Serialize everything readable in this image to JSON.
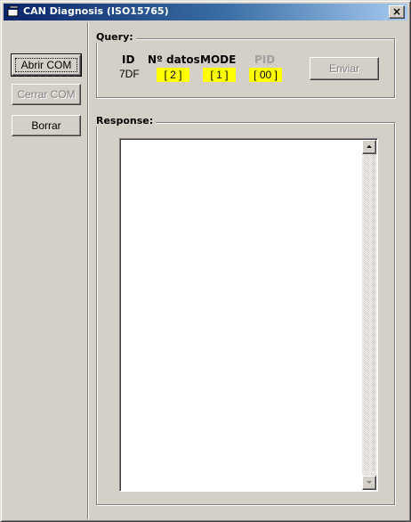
{
  "window": {
    "title": "CAN Diagnosis (ISO15765)",
    "close_glyph": "×"
  },
  "sidebar": {
    "open_label": "Abrir COM",
    "close_label": "Cerrar COM",
    "clear_label": "Borrar"
  },
  "query": {
    "group_label": "Query:",
    "id_label": "ID",
    "id_value": "7DF",
    "ndatos_label": "Nº datos",
    "ndatos_value": "2",
    "mode_label": "MODE",
    "mode_value": "1",
    "pid_label": "PID",
    "pid_value": "00",
    "send_label": "Enviar"
  },
  "response": {
    "group_label": "Response:",
    "text": ""
  },
  "colors": {
    "face": "#d4d0c8",
    "title_start": "#0a246a",
    "title_end": "#a6caf0",
    "field_highlight": "#ffff00",
    "disabled_text": "#808080"
  },
  "icons": {
    "app": "app-window-icon",
    "close": "close-icon",
    "scroll_up": "scroll-up-arrow-icon",
    "scroll_down": "scroll-down-arrow-icon"
  }
}
